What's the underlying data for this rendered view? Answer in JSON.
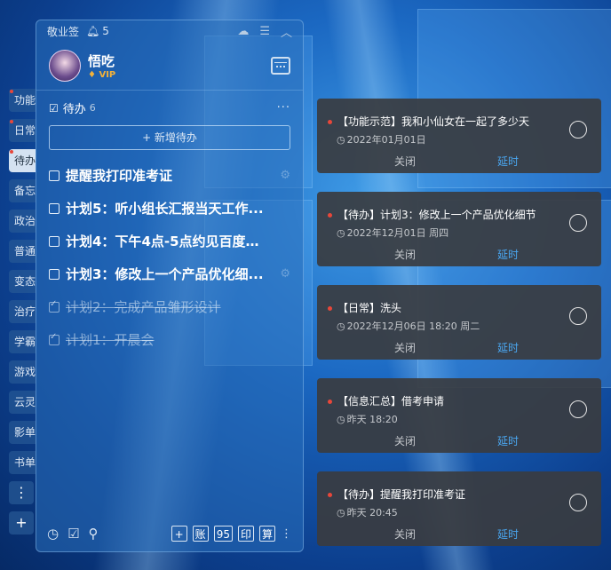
{
  "app": {
    "name": "敬业签",
    "reminder_count": "5",
    "user": {
      "name": "悟吃",
      "badge": "VIP"
    }
  },
  "side_tabs": [
    {
      "label": "功能",
      "dot": true
    },
    {
      "label": "日常",
      "dot": true
    },
    {
      "label": "待办",
      "dot": true,
      "active": true
    },
    {
      "label": "备忘",
      "dot": false
    },
    {
      "label": "政治",
      "dot": false
    },
    {
      "label": "普通",
      "dot": false
    },
    {
      "label": "变态",
      "dot": false
    },
    {
      "label": "治疗",
      "dot": false
    },
    {
      "label": "学霸",
      "dot": false
    },
    {
      "label": "游戏",
      "dot": false
    },
    {
      "label": "云灵",
      "dot": false
    },
    {
      "label": "影单",
      "dot": false
    },
    {
      "label": "书单",
      "dot": false
    }
  ],
  "todo": {
    "title": "待办",
    "count": "6",
    "add_label": "+ 新增待办",
    "items": [
      {
        "text": "提醒我打印准考证",
        "done": false
      },
      {
        "text": "计划5：听小组长汇报当天工作...",
        "done": false
      },
      {
        "text": "计划4：下午4点-5点约见百度广...",
        "done": false
      },
      {
        "text": "计划3：修改上一个产品优化细...",
        "done": false
      },
      {
        "text": "计划2：完成产品雏形设计",
        "done": true
      },
      {
        "text": "计划1：开晨会",
        "done": true
      }
    ]
  },
  "bottom_tools": [
    "+",
    "账",
    "95",
    "印",
    "算"
  ],
  "notifications": [
    {
      "title": "【功能示范】我和小仙女在一起了多少天",
      "time": "2022年01月01日"
    },
    {
      "title": "【待办】计划3：修改上一个产品优化细节",
      "time": "2022年12月01日  周四"
    },
    {
      "title": "【日常】洗头",
      "time": "2022年12月06日  18:20 周二"
    },
    {
      "title": "【信息汇总】借考申请",
      "time": "昨天  18:20"
    },
    {
      "title": "【待办】提醒我打印准考证",
      "time": "昨天  20:45"
    }
  ],
  "note_actions": {
    "close": "关闭",
    "delay": "延时"
  }
}
